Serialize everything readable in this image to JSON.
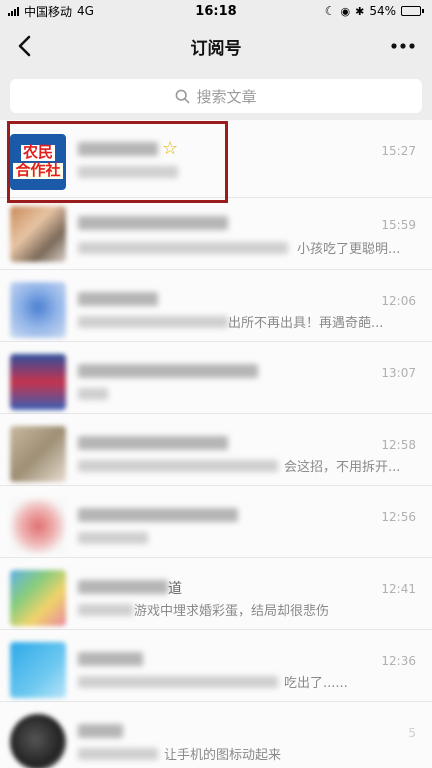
{
  "status_bar": {
    "carrier": "中国移动",
    "network": "4G",
    "time": "16:18",
    "battery_percent": "54%",
    "battery_level": 0.54
  },
  "nav": {
    "title": "订阅号",
    "back_icon": "chevron-left-icon",
    "more_icon": "more-dots-icon"
  },
  "search": {
    "placeholder": "搜索文章",
    "icon": "search-icon"
  },
  "accounts": {
    "first_logo_line1": "农民",
    "first_logo_line2": "合作社"
  },
  "rows": [
    {
      "time": "15:27",
      "title_tail": "",
      "snippet_tail": ""
    },
    {
      "time": "15:59",
      "title_tail": "",
      "snippet_tail": "小孩吃了更聪明..."
    },
    {
      "time": "12:06",
      "title_tail": "",
      "snippet_tail": "出所不再出具！再遇奇葩..."
    },
    {
      "time": "13:07",
      "title_tail": "",
      "snippet_tail": ""
    },
    {
      "time": "12:58",
      "title_tail": "",
      "snippet_tail": "会这招，不用拆开..."
    },
    {
      "time": "12:56",
      "title_tail": "",
      "snippet_tail": ""
    },
    {
      "time": "12:41",
      "title_tail": "道",
      "snippet_tail": "游戏中埋求婚彩蛋，结局却很悲伤"
    },
    {
      "time": "12:36",
      "title_tail": "",
      "snippet_tail": "吃出了......"
    },
    {
      "time": "5",
      "title_tail": "",
      "snippet_tail": "让手机的图标动起来"
    }
  ],
  "colors": {
    "highlight_border": "#9a1c1c",
    "star": "#e6b400"
  }
}
